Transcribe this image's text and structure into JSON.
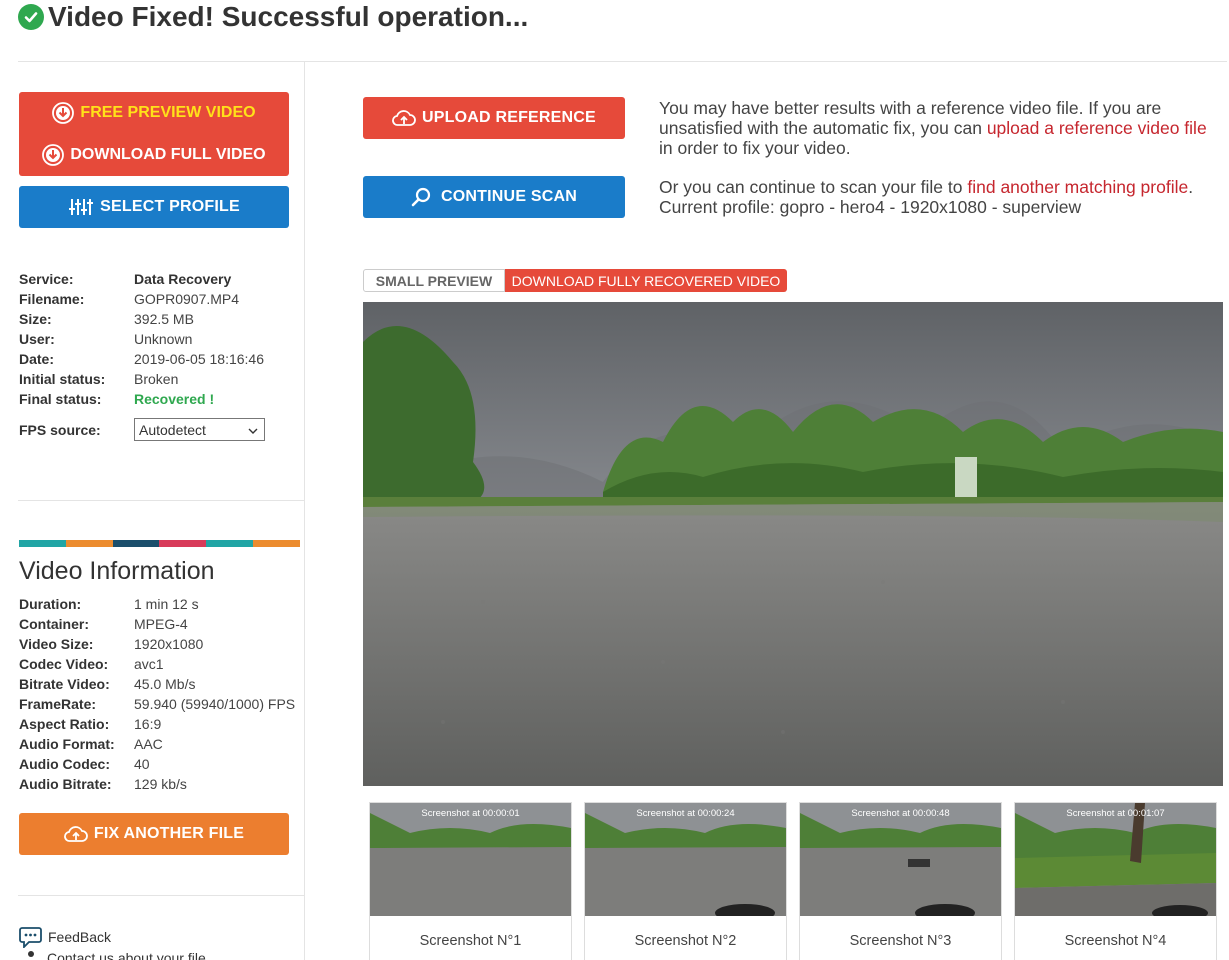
{
  "page": {
    "title": "Video Fixed! Successful operation..."
  },
  "actions": {
    "free_preview": "FREE PREVIEW VIDEO",
    "download_full": "DOWNLOAD FULL VIDEO",
    "select_profile": "SELECT PROFILE",
    "upload_reference": "UPLOAD REFERENCE",
    "continue_scan": "CONTINUE SCAN",
    "fix_another": "FIX ANOTHER FILE"
  },
  "file_info": [
    {
      "label": "Service:",
      "value": "Data Recovery"
    },
    {
      "label": "Filename:",
      "value": "GOPR0907.MP4"
    },
    {
      "label": "Size:",
      "value": "392.5 MB"
    },
    {
      "label": "User:",
      "value": "Unknown"
    },
    {
      "label": "Date:",
      "value": "2019-06-05 18:16:46"
    },
    {
      "label": "Initial status:",
      "value": "Broken"
    },
    {
      "label": "Final status:",
      "value": "Recovered !"
    }
  ],
  "fps": {
    "label": "FPS source:",
    "selected": "Autodetect"
  },
  "video_info": {
    "title": "Video Information",
    "rows": [
      {
        "label": "Duration:",
        "value": "1 min 12 s"
      },
      {
        "label": "Container:",
        "value": "MPEG-4"
      },
      {
        "label": "Video Size:",
        "value": "1920x1080"
      },
      {
        "label": "Codec Video:",
        "value": "avc1"
      },
      {
        "label": "Bitrate Video:",
        "value": "45.0 Mb/s"
      },
      {
        "label": "FrameRate:",
        "value": "59.940 (59940/1000) FPS"
      },
      {
        "label": "Aspect Ratio:",
        "value": "16:9"
      },
      {
        "label": "Audio Format:",
        "value": "AAC"
      },
      {
        "label": "Audio Codec:",
        "value": "40"
      },
      {
        "label": "Audio Bitrate:",
        "value": "129 kb/s"
      }
    ]
  },
  "reference_msg": {
    "pre": "You may have better results with a reference video file. If you are unsatisfied with the automatic fix, you can ",
    "link": "upload a reference video file",
    "post": " in order to fix your video."
  },
  "scan_msg": {
    "pre": "Or you can continue to scan your file to ",
    "link": "find another matching profile",
    "post": ". Current profile: gopro - hero4 - 1920x1080 - superview"
  },
  "tabs": {
    "small": "SMALL PREVIEW",
    "full": "DOWNLOAD FULLY RECOVERED VIDEO"
  },
  "screenshots": [
    {
      "timestamp": "Screenshot at 00:00:01",
      "label": "Screenshot N°1"
    },
    {
      "timestamp": "Screenshot at 00:00:24",
      "label": "Screenshot N°2"
    },
    {
      "timestamp": "Screenshot at 00:00:48",
      "label": "Screenshot N°3"
    },
    {
      "timestamp": "Screenshot at 00:01:07",
      "label": "Screenshot N°4"
    }
  ],
  "footer": {
    "feedback": "FeedBack",
    "contact": "Contact us about your file"
  },
  "colors": {
    "red": "#e64a3a",
    "blue": "#1a7cc9",
    "orange": "#ec7e2f",
    "green": "#2fa84f",
    "colorbar": [
      "#21a5a5",
      "#ec8c2f",
      "#1b4e6b",
      "#d83b5a",
      "#21a5a5",
      "#ec8c2f"
    ]
  },
  "icons": [
    "check-circle-icon",
    "download-circle-icon",
    "sliders-icon",
    "cloud-upload-icon",
    "magnifier-icon",
    "chat-bubble-icon",
    "user-icon",
    "chevron-down-icon"
  ]
}
